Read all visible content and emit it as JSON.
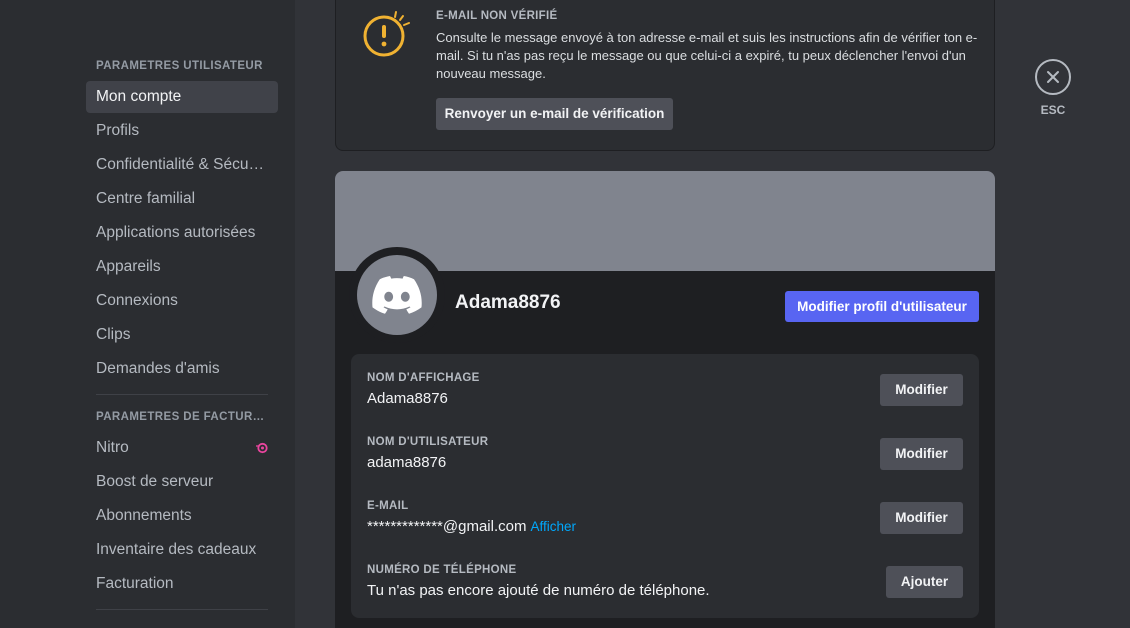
{
  "sidebar": {
    "section1_header": "PARAMÈTRES UTILISATEUR",
    "section1_items": [
      {
        "label": "Mon compte"
      },
      {
        "label": "Profils"
      },
      {
        "label": "Confidentialité & Sécurité"
      },
      {
        "label": "Centre familial"
      },
      {
        "label": "Applications autorisées"
      },
      {
        "label": "Appareils"
      },
      {
        "label": "Connexions"
      },
      {
        "label": "Clips"
      },
      {
        "label": "Demandes d'amis"
      }
    ],
    "section2_header": "PARAMÈTRES DE FACTURATION",
    "section2_items": [
      {
        "label": "Nitro",
        "icon": "nitro-icon"
      },
      {
        "label": "Boost de serveur"
      },
      {
        "label": "Abonnements"
      },
      {
        "label": "Inventaire des cadeaux"
      },
      {
        "label": "Facturation"
      }
    ]
  },
  "alert": {
    "icon": "warning-icon",
    "title": "E-MAIL NON VÉRIFIÉ",
    "text": "Consulte le message envoyé à ton adresse e-mail et suis les instructions afin de vérifier ton e-mail. Si tu n'as pas reçu le message ou que celui-ci a expiré, tu peux déclencher l'envoi d'un nouveau message.",
    "button": "Renvoyer un e-mail de vérification"
  },
  "profile": {
    "username": "Adama8876",
    "edit_button": "Modifier profil d'utilisateur",
    "fields": [
      {
        "label": "NOM D'AFFICHAGE",
        "value": "Adama8876",
        "button": "Modifier"
      },
      {
        "label": "NOM D'UTILISATEUR",
        "value": "adama8876",
        "button": "Modifier"
      },
      {
        "label": "E-MAIL",
        "value": "*************@gmail.com",
        "link": "Afficher",
        "button": "Modifier"
      },
      {
        "label": "NUMÉRO DE TÉLÉPHONE",
        "value": "Tu n'as pas encore ajouté de numéro de téléphone.",
        "button": "Ajouter"
      }
    ]
  },
  "close": {
    "label": "ESC",
    "icon": "close-icon"
  },
  "colors": {
    "accent": "#5865f2",
    "warning": "#f0b232",
    "link": "#00a8fc",
    "nitro": "#eb459f"
  }
}
